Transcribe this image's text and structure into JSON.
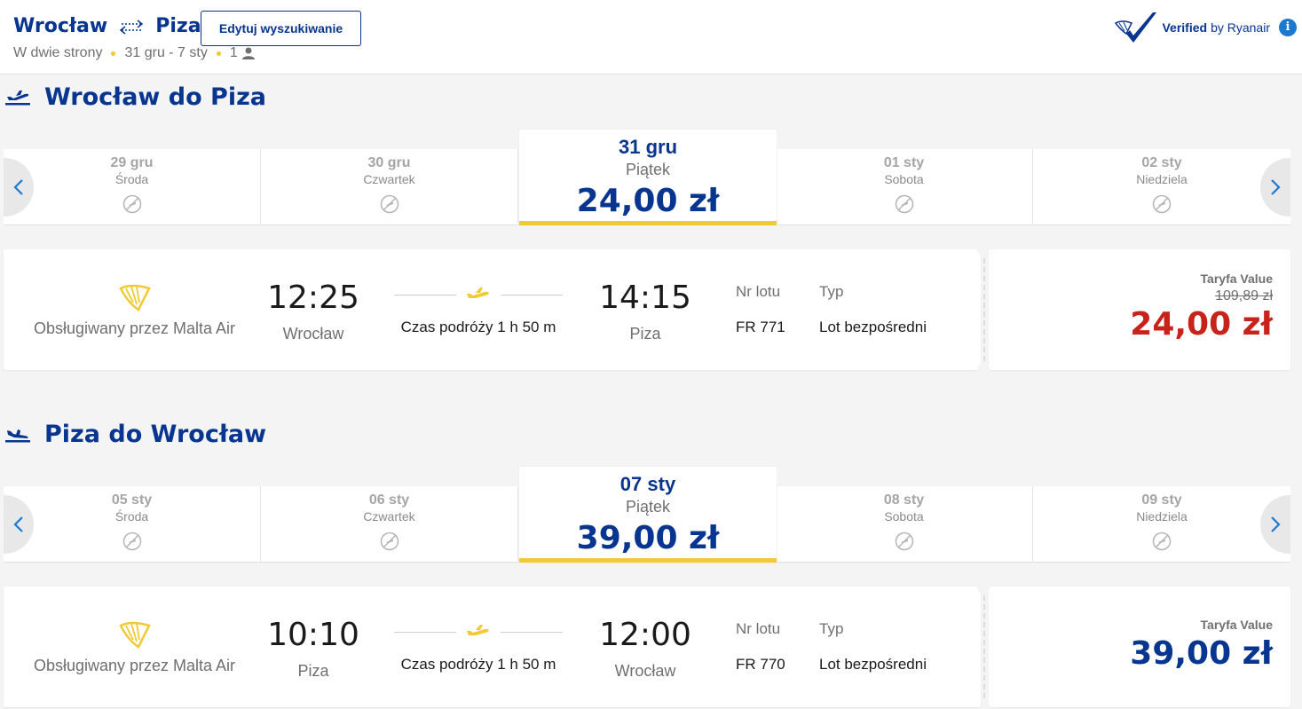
{
  "header": {
    "from": "Wrocław",
    "to": "Piza",
    "edit_button": "Edytuj wyszukiwanie",
    "trip_type": "W dwie strony",
    "dates": "31 gru - 7 sty",
    "passengers": "1",
    "verified_bold": "Verified",
    "verified_rest": "by Ryanair",
    "info_icon": "i"
  },
  "outbound": {
    "title": "Wrocław do Piza",
    "dates": [
      {
        "date": "29 gru",
        "weekday": "Środa"
      },
      {
        "date": "30 gru",
        "weekday": "Czwartek"
      },
      {
        "date": "01 sty",
        "weekday": "Sobota"
      },
      {
        "date": "02 sty",
        "weekday": "Niedziela"
      }
    ],
    "active": {
      "date": "31 gru",
      "weekday": "Piątek",
      "price": "24,00 zł"
    },
    "flight": {
      "operator": "Obsługiwany przez Malta Air",
      "dep_time": "12:25",
      "dep_city": "Wrocław",
      "duration": "Czas podróży 1 h 50 m",
      "arr_time": "14:15",
      "arr_city": "Piza",
      "flight_no_label": "Nr lotu",
      "flight_no": "FR 771",
      "type_label": "Typ",
      "type": "Lot bezpośredni",
      "fare_label": "Taryfa Value",
      "old_price": "109,89 zł",
      "price": "24,00 zł",
      "price_color": "#c8231b"
    }
  },
  "return": {
    "title": "Piza do Wrocław",
    "dates": [
      {
        "date": "05 sty",
        "weekday": "Środa"
      },
      {
        "date": "06 sty",
        "weekday": "Czwartek"
      },
      {
        "date": "08 sty",
        "weekday": "Sobota"
      },
      {
        "date": "09 sty",
        "weekday": "Niedziela"
      }
    ],
    "active": {
      "date": "07 sty",
      "weekday": "Piątek",
      "price": "39,00 zł"
    },
    "flight": {
      "operator": "Obsługiwany przez Malta Air",
      "dep_time": "10:10",
      "dep_city": "Piza",
      "duration": "Czas podróży 1 h 50 m",
      "arr_time": "12:00",
      "arr_city": "Wrocław",
      "flight_no_label": "Nr lotu",
      "flight_no": "FR 770",
      "type_label": "Typ",
      "type": "Lot bezpośredni",
      "fare_label": "Taryfa Value",
      "price": "39,00 zł",
      "price_color": "#073590"
    }
  },
  "colors": {
    "brand_blue": "#073590",
    "accent_yellow": "#f1c933",
    "promo_red": "#c8231b"
  }
}
